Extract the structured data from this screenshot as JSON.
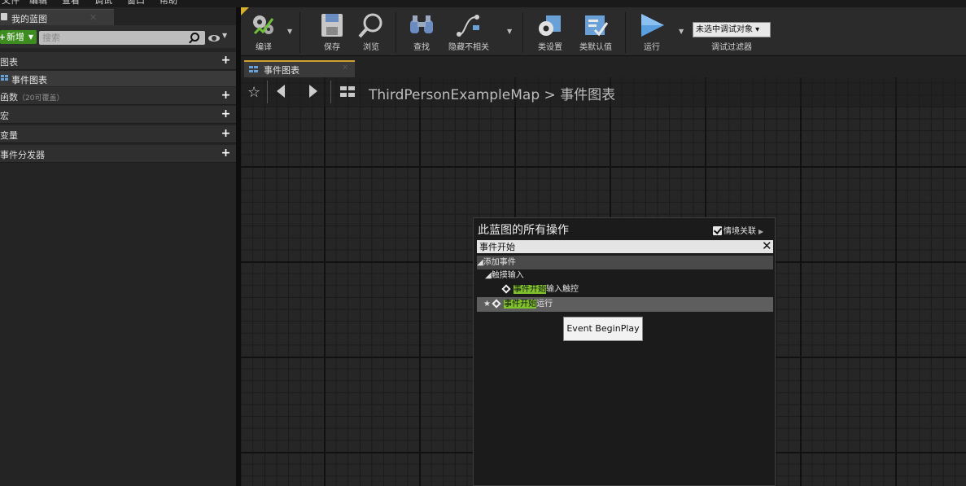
{
  "menu": {
    "items": [
      "文件",
      "编辑",
      "查看",
      "调试",
      "窗口",
      "帮助"
    ]
  },
  "my_blueprint": {
    "tab_label": "我的蓝图",
    "new_button": "新增",
    "search_placeholder": "搜索",
    "sections": {
      "graphs": "图表",
      "graph_item": "事件图表",
      "functions": "函数",
      "functions_sub": "（20可覆盖）",
      "macros": "宏",
      "variables": "变量",
      "dispatchers": "事件分发器"
    }
  },
  "toolbar": {
    "compile": "编译",
    "save": "保存",
    "browse": "浏览",
    "find": "查找",
    "hide_unrelated": "隐藏不相关",
    "class_settings": "类设置",
    "class_defaults": "类默认值",
    "play": "运行",
    "debug_select": "未选中调试对象",
    "debug_filter": "调试过滤器"
  },
  "graph": {
    "tab_label": "事件图表",
    "breadcrumb_map": "ThirdPersonExampleMap",
    "breadcrumb_sep": ">",
    "breadcrumb_graph": "事件图表"
  },
  "action_menu": {
    "title": "此蓝图的所有操作",
    "context_label": "情境关联",
    "search_value": "事件开始",
    "category_add_event": "添加事件",
    "category_touch": "触摸输入",
    "item1_hl": "事件开始",
    "item1_rest": "输入触控",
    "item2_hl": "事件开始",
    "item2_rest": "运行",
    "tooltip": "Event BeginPlay"
  },
  "colors": {
    "new_button": "#3d8c20",
    "highlight": "#7ec12a",
    "tab_accent": "#d0a030"
  }
}
